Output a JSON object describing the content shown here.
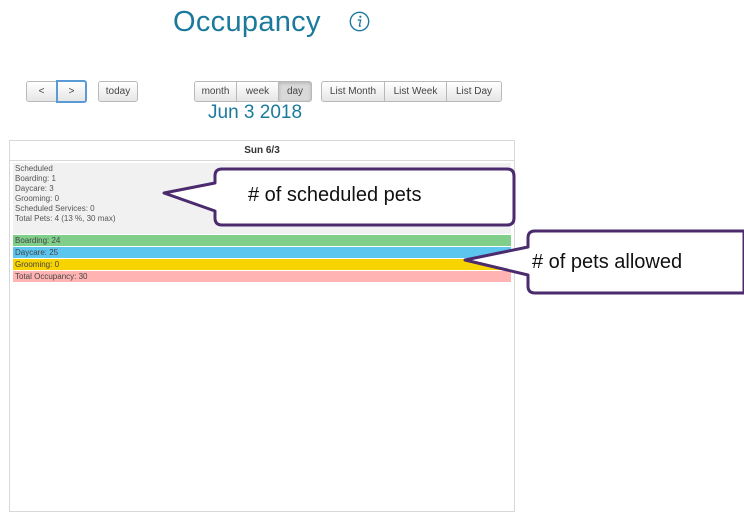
{
  "title": "Occupancy",
  "info_icon": "info-icon",
  "nav": {
    "prev": "<",
    "next": ">",
    "today": "today"
  },
  "views": [
    "month",
    "week",
    "day"
  ],
  "list_views": [
    "List Month",
    "List Week",
    "List Day"
  ],
  "active_view": "day",
  "date_title": "Jun 3 2018",
  "calendar": {
    "day_header": "Sun 6/3",
    "scheduled": [
      "Scheduled",
      "Boarding: 1",
      "Daycare: 3",
      "Grooming: 0",
      "Scheduled Services: 0",
      "Total Pets: 4 (13 %, 30 max)"
    ],
    "capacity_bars": [
      {
        "label": "Boarding: 24",
        "color": "#7fcf8a"
      },
      {
        "label": "Daycare: 25",
        "color": "#5cc6ee"
      },
      {
        "label": "Grooming: 0",
        "color": "#f7d300"
      },
      {
        "label": "Total Occupancy: 30",
        "color": "#ffb3b3"
      }
    ]
  },
  "annotations": {
    "scheduled": "# of scheduled pets",
    "allowed": "# of pets allowed"
  },
  "colors": {
    "title": "#1b7a9c",
    "callout_border": "#4b2a6e"
  }
}
